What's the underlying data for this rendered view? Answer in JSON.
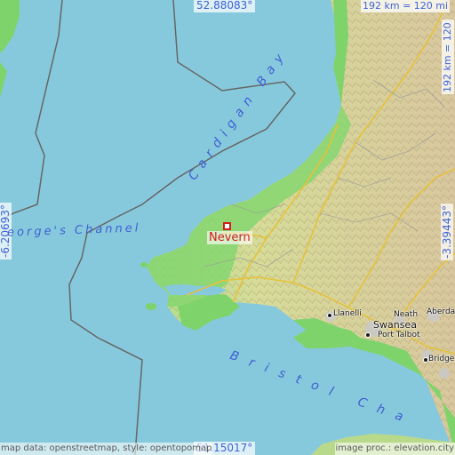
{
  "map": {
    "highlighted_place": "Nevern",
    "coordinates": {
      "north": "52.88083°",
      "south": "51.15017°",
      "west": "-6.20693°",
      "east": "-3.39443°"
    },
    "scale": {
      "horizontal": "192 km = 120 mi",
      "vertical": "192 km = 120 mi"
    },
    "water_labels": {
      "cardigan_bay": "Cardigan Bay",
      "st_georges_channel": "eorge's Channel",
      "bristol_channel": "Bristol Cha"
    },
    "towns": {
      "swansea": "Swansea",
      "llanelli": "Llanelli",
      "neath": "Neath",
      "aberdare": "Aberda",
      "port_talbot": "Port Talbot",
      "bridgend": "Bridge"
    },
    "credits": {
      "left": "map data: openstreetmap, style: opentopomap",
      "right": "image proc.: elevation.city"
    }
  },
  "colors": {
    "sea": "#87c9dc",
    "coast_green": "#7fd36b",
    "land_light": "#d8dc9a",
    "land_hills": "#c6b98c",
    "highlight": "#d51c1c",
    "label_blue": "#3f63d6"
  }
}
